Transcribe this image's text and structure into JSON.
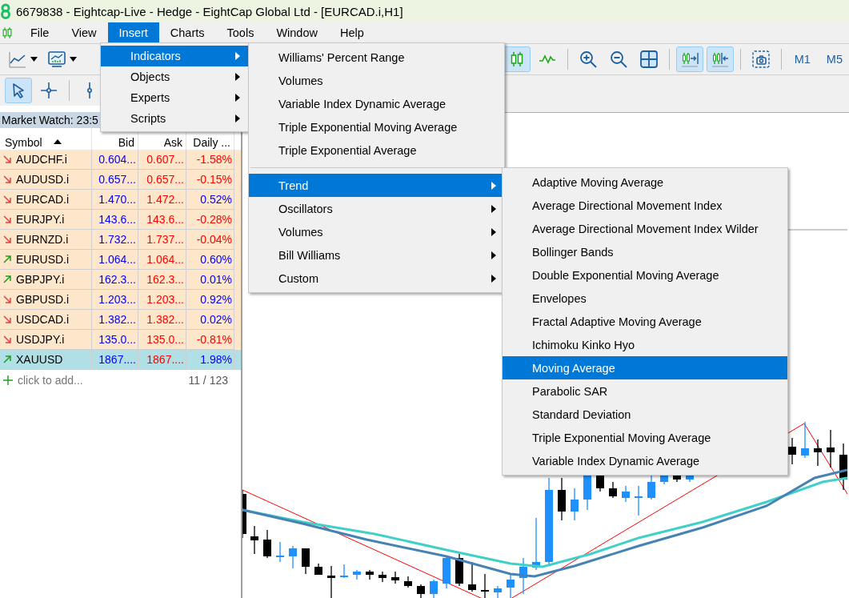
{
  "window": {
    "title": "6679838 - Eightcap-Live - Hedge - EightCap Global Ltd - [EURCAD.i,H1]"
  },
  "menu_bar": [
    {
      "label": "File",
      "selected": false
    },
    {
      "label": "View",
      "selected": false
    },
    {
      "label": "Insert",
      "selected": true
    },
    {
      "label": "Charts",
      "selected": false
    },
    {
      "label": "Tools",
      "selected": false
    },
    {
      "label": "Window",
      "selected": false
    },
    {
      "label": "Help",
      "selected": false
    }
  ],
  "toolbar": {
    "left_tools": [
      {
        "kind": "line-chart",
        "selected": false
      },
      {
        "kind": "chart-window",
        "selected": false
      }
    ],
    "drawing_tools": [
      {
        "kind": "cursor",
        "selected": true
      },
      {
        "kind": "crosshair",
        "selected": false
      },
      {
        "kind": "vertical-line",
        "selected": false
      }
    ],
    "right_tools": [
      {
        "kind": "candles",
        "selected": true
      },
      {
        "kind": "line",
        "selected": false
      },
      {
        "kind": "zoom-in",
        "selected": false
      },
      {
        "kind": "zoom-out",
        "selected": false
      },
      {
        "kind": "tile",
        "selected": false
      },
      {
        "kind": "autoscroll",
        "selected": true
      },
      {
        "kind": "chart-shift",
        "selected": true
      },
      {
        "kind": "screenshot",
        "selected": false
      }
    ],
    "periods": [
      {
        "label": "M1",
        "selected": false
      },
      {
        "label": "M5",
        "selected": false
      }
    ]
  },
  "market_watch": {
    "title": "Market Watch: 23:5",
    "columns": [
      "Symbol",
      "Bid",
      "Ask",
      "Daily ..."
    ],
    "rows": [
      {
        "symbol": "AUDCHF.i",
        "bid": "0.604...",
        "ask": "0.607...",
        "change": "-1.58%",
        "trend_up": false,
        "change_positive": false,
        "selected": false
      },
      {
        "symbol": "AUDUSD.i",
        "bid": "0.657...",
        "ask": "0.657...",
        "change": "-0.15%",
        "trend_up": false,
        "change_positive": false,
        "selected": false
      },
      {
        "symbol": "EURCAD.i",
        "bid": "1.470...",
        "ask": "1.472...",
        "change": "0.52%",
        "trend_up": false,
        "change_positive": true,
        "selected": false
      },
      {
        "symbol": "EURJPY.i",
        "bid": "143.6...",
        "ask": "143.6...",
        "change": "-0.28%",
        "trend_up": false,
        "change_positive": false,
        "selected": false
      },
      {
        "symbol": "EURNZD.i",
        "bid": "1.732...",
        "ask": "1.737...",
        "change": "-0.04%",
        "trend_up": false,
        "change_positive": false,
        "selected": false
      },
      {
        "symbol": "EURUSD.i",
        "bid": "1.064...",
        "ask": "1.064...",
        "change": "0.60%",
        "trend_up": true,
        "change_positive": true,
        "selected": false
      },
      {
        "symbol": "GBPJPY.i",
        "bid": "162.3...",
        "ask": "162.3...",
        "change": "0.01%",
        "trend_up": true,
        "change_positive": true,
        "selected": false
      },
      {
        "symbol": "GBPUSD.i",
        "bid": "1.203...",
        "ask": "1.203...",
        "change": "0.92%",
        "trend_up": false,
        "change_positive": true,
        "selected": false
      },
      {
        "symbol": "USDCAD.i",
        "bid": "1.382...",
        "ask": "1.382...",
        "change": "0.02%",
        "trend_up": false,
        "change_positive": true,
        "selected": false
      },
      {
        "symbol": "USDJPY.i",
        "bid": "135.0...",
        "ask": "135.0...",
        "change": "-0.81%",
        "trend_up": false,
        "change_positive": false,
        "selected": false
      },
      {
        "symbol": "XAUUSD",
        "bid": "1867....",
        "ask": "1867....",
        "change": "1.98%",
        "trend_up": true,
        "change_positive": true,
        "selected": true
      }
    ],
    "add_hint": "click to add...",
    "count": "11 / 123"
  },
  "open_menus": [
    {
      "items": [
        {
          "kind": "item",
          "label": "Indicators",
          "selected": true,
          "has_submenu": true
        },
        {
          "kind": "item",
          "label": "Objects",
          "selected": false,
          "has_submenu": true
        },
        {
          "kind": "item",
          "label": "Experts",
          "selected": false,
          "has_submenu": true
        },
        {
          "kind": "item",
          "label": "Scripts",
          "selected": false,
          "has_submenu": true
        }
      ]
    },
    {
      "items": [
        {
          "kind": "item",
          "label": "Williams' Percent Range",
          "selected": false,
          "has_submenu": false
        },
        {
          "kind": "item",
          "label": "Volumes",
          "selected": false,
          "has_submenu": false
        },
        {
          "kind": "item",
          "label": "Variable Index Dynamic Average",
          "selected": false,
          "has_submenu": false
        },
        {
          "kind": "item",
          "label": "Triple Exponential Moving Average",
          "selected": false,
          "has_submenu": false
        },
        {
          "kind": "item",
          "label": "Triple Exponential Average",
          "selected": false,
          "has_submenu": false
        },
        {
          "kind": "separator"
        },
        {
          "kind": "item",
          "label": "Trend",
          "selected": true,
          "has_submenu": true
        },
        {
          "kind": "item",
          "label": "Oscillators",
          "selected": false,
          "has_submenu": true
        },
        {
          "kind": "item",
          "label": "Volumes",
          "selected": false,
          "has_submenu": true
        },
        {
          "kind": "item",
          "label": "Bill Williams",
          "selected": false,
          "has_submenu": true
        },
        {
          "kind": "item",
          "label": "Custom",
          "selected": false,
          "has_submenu": true
        }
      ]
    },
    {
      "items": [
        {
          "kind": "item",
          "label": "Adaptive Moving Average",
          "selected": false,
          "has_submenu": false
        },
        {
          "kind": "item",
          "label": "Average Directional Movement Index",
          "selected": false,
          "has_submenu": false
        },
        {
          "kind": "item",
          "label": "Average Directional Movement Index Wilder",
          "selected": false,
          "has_submenu": false
        },
        {
          "kind": "item",
          "label": "Bollinger Bands",
          "selected": false,
          "has_submenu": false
        },
        {
          "kind": "item",
          "label": "Double Exponential Moving Average",
          "selected": false,
          "has_submenu": false
        },
        {
          "kind": "item",
          "label": "Envelopes",
          "selected": false,
          "has_submenu": false
        },
        {
          "kind": "item",
          "label": "Fractal Adaptive Moving Average",
          "selected": false,
          "has_submenu": false
        },
        {
          "kind": "item",
          "label": "Ichimoku Kinko Hyo",
          "selected": false,
          "has_submenu": false
        },
        {
          "kind": "item",
          "label": "Moving Average",
          "selected": true,
          "has_submenu": false
        },
        {
          "kind": "item",
          "label": "Parabolic SAR",
          "selected": false,
          "has_submenu": false
        },
        {
          "kind": "item",
          "label": "Standard Deviation",
          "selected": false,
          "has_submenu": false
        },
        {
          "kind": "item",
          "label": "Triple Exponential Moving Average",
          "selected": false,
          "has_submenu": false
        },
        {
          "kind": "item",
          "label": "Variable Index Dynamic Average",
          "selected": false,
          "has_submenu": false
        }
      ]
    }
  ]
}
